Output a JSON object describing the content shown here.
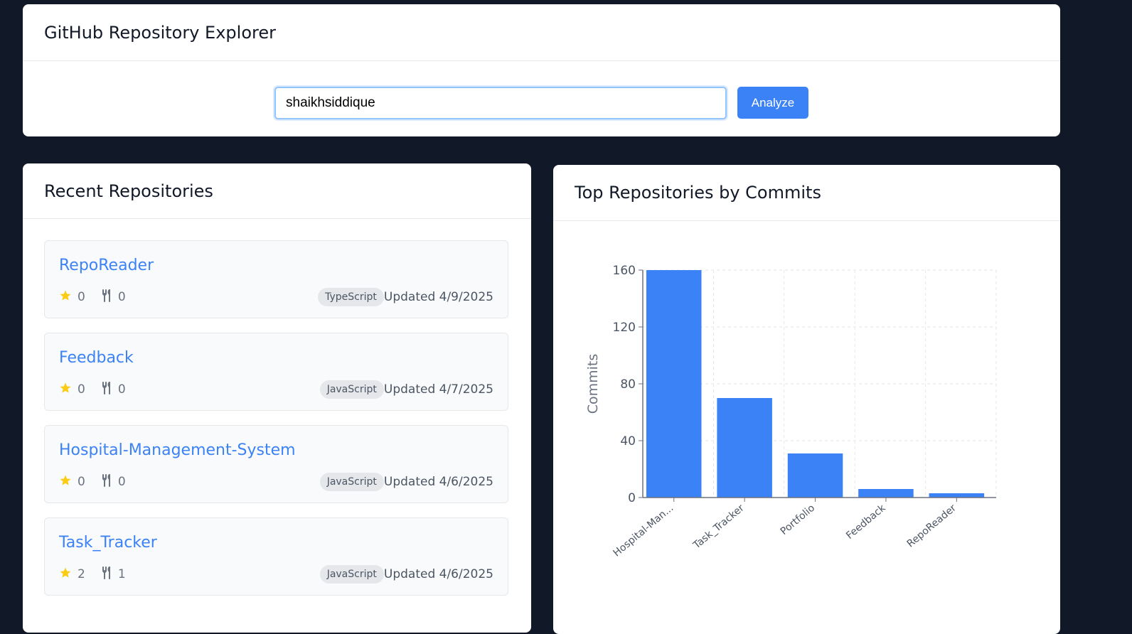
{
  "header": {
    "title": "GitHub Repository Explorer"
  },
  "search": {
    "value": "shaikhsiddique",
    "button_label": "Analyze"
  },
  "recent": {
    "title": "Recent Repositories",
    "repos": [
      {
        "name": "RepoReader",
        "stars": "0",
        "forks": "0",
        "language": "TypeScript",
        "updated": "Updated 4/9/2025"
      },
      {
        "name": "Feedback",
        "stars": "0",
        "forks": "0",
        "language": "JavaScript",
        "updated": "Updated 4/7/2025"
      },
      {
        "name": "Hospital-Management-System",
        "stars": "0",
        "forks": "0",
        "language": "JavaScript",
        "updated": "Updated 4/6/2025"
      },
      {
        "name": "Task_Tracker",
        "stars": "2",
        "forks": "1",
        "language": "JavaScript",
        "updated": "Updated 4/6/2025"
      }
    ]
  },
  "chart": {
    "title": "Top Repositories by Commits"
  },
  "colors": {
    "accent": "#3b82f6",
    "star": "#facc15"
  },
  "icons": {
    "star": "star-icon",
    "fork": "fork-icon"
  },
  "chart_data": {
    "type": "bar",
    "categories": [
      "Hospital-Man...",
      "Task_Tracker",
      "Portfolio",
      "Feedback",
      "RepoReader"
    ],
    "values": [
      160,
      70,
      31,
      6,
      3
    ],
    "ylabel": "Commits",
    "ylim": [
      0,
      160
    ],
    "yticks": [
      0,
      40,
      80,
      120,
      160
    ],
    "grid": true
  }
}
